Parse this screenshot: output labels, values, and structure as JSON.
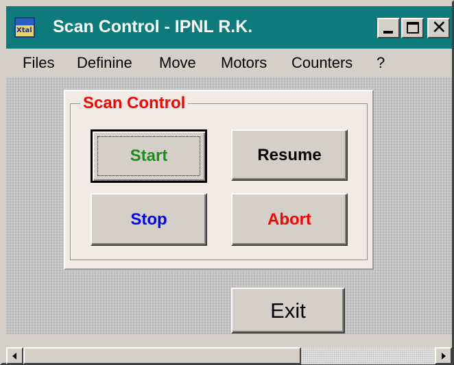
{
  "window": {
    "title": "Scan Control - IPNL R.K.",
    "icon_text": "Xtal",
    "icon": "xtal-app-icon",
    "title_color": "#0d7b7b"
  },
  "titlebar_buttons": {
    "minimize_icon": "minimize-icon",
    "maximize_icon": "maximize-icon",
    "close_icon": "close-icon",
    "close_glyph": "✕"
  },
  "menu": {
    "items": [
      "Files",
      "Definine",
      "Move",
      "Motors",
      "Counters",
      "?"
    ]
  },
  "scan_group": {
    "title": "Scan Control",
    "title_color": "#ff0000",
    "buttons": {
      "start": {
        "label": "Start",
        "color": "#228b22"
      },
      "resume": {
        "label": "Resume",
        "color": "#000000"
      },
      "stop": {
        "label": "Stop",
        "color": "#0000ff"
      },
      "abort": {
        "label": "Abort",
        "color": "#ff0000"
      }
    }
  },
  "exit_button": {
    "label": "Exit"
  },
  "scrollbar": {
    "left_icon": "scroll-left-arrow-icon",
    "right_icon": "scroll-right-arrow-icon"
  }
}
